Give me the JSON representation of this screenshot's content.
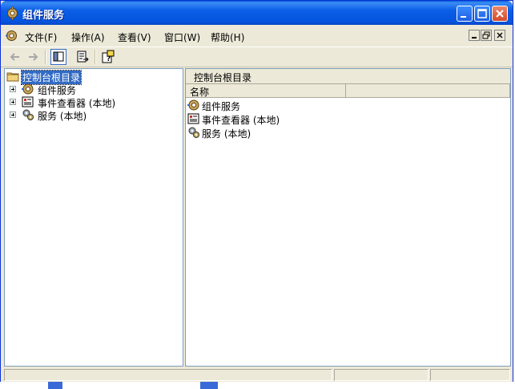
{
  "window": {
    "title": "组件服务",
    "controls": [
      "minimize",
      "maximize",
      "close"
    ]
  },
  "menubar": {
    "items": [
      {
        "label": "文件(F)"
      },
      {
        "label": "操作(A)"
      },
      {
        "label": "查看(V)"
      },
      {
        "label": "窗口(W)"
      },
      {
        "label": "帮助(H)"
      }
    ]
  },
  "toolbar": {
    "buttons": [
      "back-arrow-icon",
      "forward-arrow-icon",
      "show-hide-tree-icon",
      "export-list-icon",
      "help-icon"
    ]
  },
  "tree": {
    "root": {
      "label": "控制台根目录",
      "icon": "folder-icon",
      "selected": true
    },
    "children": [
      {
        "label": "组件服务",
        "icon": "component-services-icon"
      },
      {
        "label": "事件查看器 (本地)",
        "icon": "event-viewer-icon"
      },
      {
        "label": "服务 (本地)",
        "icon": "services-gear-icon"
      }
    ]
  },
  "detail": {
    "header": "控制台根目录",
    "columns": [
      {
        "label": "名称"
      },
      {
        "label": ""
      }
    ],
    "items": [
      {
        "label": "组件服务",
        "icon": "component-services-icon"
      },
      {
        "label": "事件查看器 (本地)",
        "icon": "event-viewer-icon"
      },
      {
        "label": "服务 (本地)",
        "icon": "services-gear-icon"
      }
    ]
  },
  "colors": {
    "titlebar": "#0b5ee6",
    "selection": "#316ac5",
    "chrome": "#ece9d8"
  }
}
